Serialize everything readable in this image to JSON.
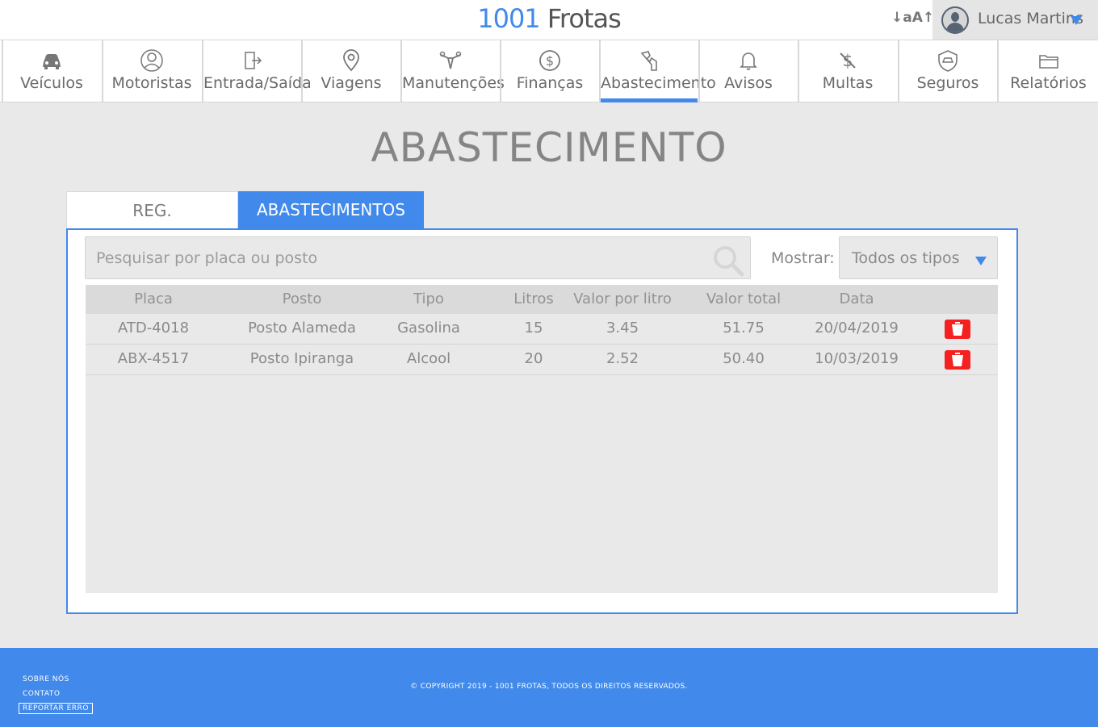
{
  "header": {
    "brand_number": "1001",
    "brand_name": "Frotas",
    "font_size_toggle": "↓aA↑",
    "user_name": "Lucas Martins"
  },
  "nav": {
    "items": [
      {
        "label": "Veículos",
        "icon": "car-icon"
      },
      {
        "label": "Motoristas",
        "icon": "driver-icon"
      },
      {
        "label": "Entrada/Saída",
        "icon": "door-icon"
      },
      {
        "label": "Viagens",
        "icon": "map-pin-icon"
      },
      {
        "label": "Manutenções",
        "icon": "wrench-icon"
      },
      {
        "label": "Finanças",
        "icon": "dollar-icon"
      },
      {
        "label": "Abastecimento",
        "icon": "fuel-nozzle-icon"
      },
      {
        "label": "Avisos",
        "icon": "bell-icon"
      },
      {
        "label": "Multas",
        "icon": "ticket-icon"
      },
      {
        "label": "Seguros",
        "icon": "shield-car-icon"
      },
      {
        "label": "Relatórios",
        "icon": "folder-icon"
      }
    ],
    "active": "Abastecimento"
  },
  "page": {
    "title": "ABASTECIMENTO",
    "tabs": [
      {
        "label": "REG. ABASTECIMENTO",
        "active": false
      },
      {
        "label": "ABASTECIMENTOS FEITOS",
        "active": true
      }
    ]
  },
  "filters": {
    "search_placeholder": "Pesquisar por placa ou posto",
    "show_label": "Mostrar:",
    "show_value": "Todos os tipos"
  },
  "table": {
    "columns": [
      "Placa",
      "Posto",
      "Tipo",
      "Litros",
      "Valor por litro",
      "Valor total",
      "Data"
    ],
    "rows": [
      [
        "ATD-4018",
        "Posto Alameda",
        "Gasolina",
        "15",
        "3.45",
        "51.75",
        "20/04/2019"
      ],
      [
        "ABX-4517",
        "Posto Ipiranga",
        "Alcool",
        "20",
        "2.52",
        "50.40",
        "10/03/2019"
      ]
    ]
  },
  "footer": {
    "about": "SOBRE NÓS",
    "contact": "CONTATO",
    "report": "REPORTAR ERRO",
    "copyright": "© COPYRIGHT 2019 - 1001 FROTAS, TODOS OS DIREITOS RESERVADOS."
  },
  "colors": {
    "accent": "#4189ea",
    "delete": "#f52020",
    "background": "#e9e9e9"
  }
}
